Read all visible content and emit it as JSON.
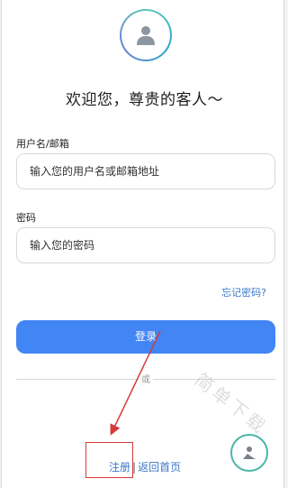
{
  "header": {
    "avatar_icon": "user-avatar-icon",
    "welcome": "欢迎您，尊贵的客人〜"
  },
  "form": {
    "username_label": "用户名/邮箱",
    "username_placeholder": "输入您的用户名或邮箱地址",
    "password_label": "密码",
    "password_placeholder": "输入您的密码",
    "forgot_link": "忘记密码?",
    "login_button": "登录",
    "or_text": "或"
  },
  "footer": {
    "register_link": "注册",
    "separator": "|",
    "home_link": "返回首页"
  },
  "watermark": "简单下载",
  "colors": {
    "primary": "#4285f4",
    "link": "#3b78c9",
    "annotation": "#d43c3c",
    "avatar_ring": "#2ea7c9"
  }
}
